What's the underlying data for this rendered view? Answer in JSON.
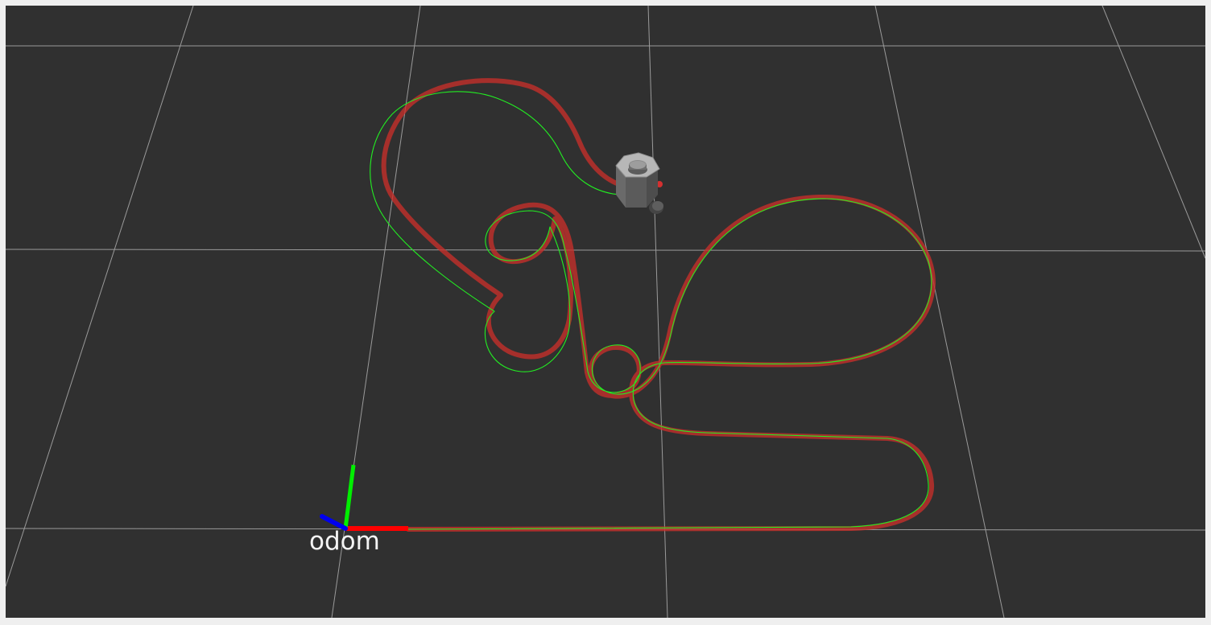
{
  "viewer": {
    "background_color": "#303030",
    "grid_color": "#9a9a9a"
  },
  "frames": [
    {
      "label": "odom",
      "axes": {
        "x_color": "#ff0000",
        "y_color": "#00ff00",
        "z_color": "#0000ff"
      }
    }
  ],
  "paths": [
    {
      "color": "#c8302a",
      "style": "thick"
    },
    {
      "color": "#22ee22",
      "style": "thin"
    }
  ],
  "robot": {
    "model": "robot-model",
    "color": "#8a8a8a"
  }
}
